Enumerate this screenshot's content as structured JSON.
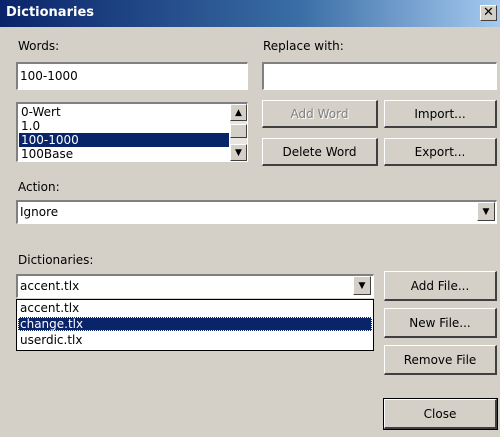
{
  "window": {
    "title": "Dictionaries",
    "close_glyph": "✕"
  },
  "words": {
    "label": "Words:",
    "value": "100-1000"
  },
  "replace": {
    "label": "Replace with:",
    "value": ""
  },
  "word_list": {
    "items": [
      "0-Wert",
      "1.0",
      "100-1000",
      "100Base"
    ],
    "selected": "100-1000"
  },
  "buttons": {
    "add_word": "Add Word",
    "import": "Import...",
    "delete_word": "Delete Word",
    "export": "Export...",
    "add_file": "Add File...",
    "new_file": "New File...",
    "remove_file": "Remove File",
    "close": "Close"
  },
  "action": {
    "label": "Action:",
    "value": "Ignore"
  },
  "dictionaries": {
    "label": "Dictionaries:",
    "value": "accent.tlx",
    "options": [
      "accent.tlx",
      "change.tlx",
      "userdic.tlx"
    ],
    "highlighted": "change.tlx"
  },
  "icons": {
    "up": "scroll-up-arrow",
    "down": "scroll-down-arrow",
    "dropdown": "dropdown-arrow"
  }
}
